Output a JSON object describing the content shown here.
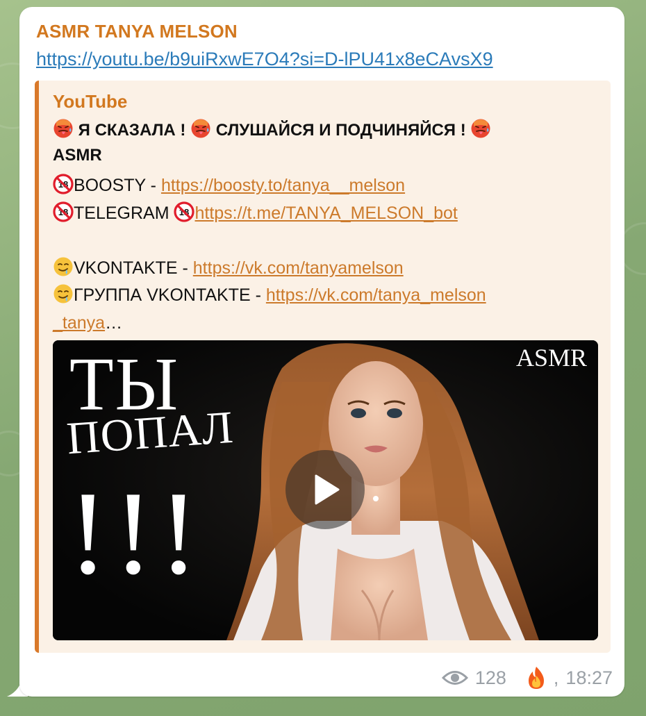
{
  "message": {
    "sender": "ASMR TANYA MELSON",
    "link": "https://youtu.be/b9uiRxwE7O4?si=D-lPU41x8eCAvsX9"
  },
  "preview": {
    "site_name": "YouTube",
    "title_part1": "Я СКАЗАЛА !",
    "title_part2": "СЛУШАЙСЯ И ПОДЧИНЯЙСЯ !",
    "title_part3": "ASMR",
    "desc": {
      "boosty_label": "BOOSTY - ",
      "boosty_link": "https://boosty.to/tanya__melson",
      "telegram_label": "TELEGRAM ",
      "telegram_link": "https://t.me/TANYA_MELSON_bot",
      "vk_label": "VKONTAKTE - ",
      "vk_link": "https://vk.com/tanyamelson",
      "vk_group_label": "ГРУППА VKONTAKTE - ",
      "vk_group_link_part1": "https://vk.com/tanya_melson",
      "vk_group_link_part2": "_tanya",
      "ellipsis": "…"
    },
    "thumbnail": {
      "text_1": "ТЫ",
      "text_2": "ПОПАЛ",
      "text_3": "!!!",
      "watermark": "ASMR"
    }
  },
  "footer": {
    "views": "128",
    "reaction": "fire-emoji",
    "time": "18:27"
  },
  "icons": {
    "hot_face": "hot-face-emoji",
    "no_under_18": "no-one-under-18-emoji",
    "drooling": "drooling-face-emoji",
    "play": "play-icon",
    "views": "eye-icon"
  },
  "colors": {
    "sender_accent": "#d2781f",
    "link_blue": "#2b7bb9",
    "preview_bg": "#fbf1e6",
    "preview_bar": "#d9792a",
    "preview_link": "#cc7a2b",
    "meta_gray": "#9aa0a6"
  }
}
